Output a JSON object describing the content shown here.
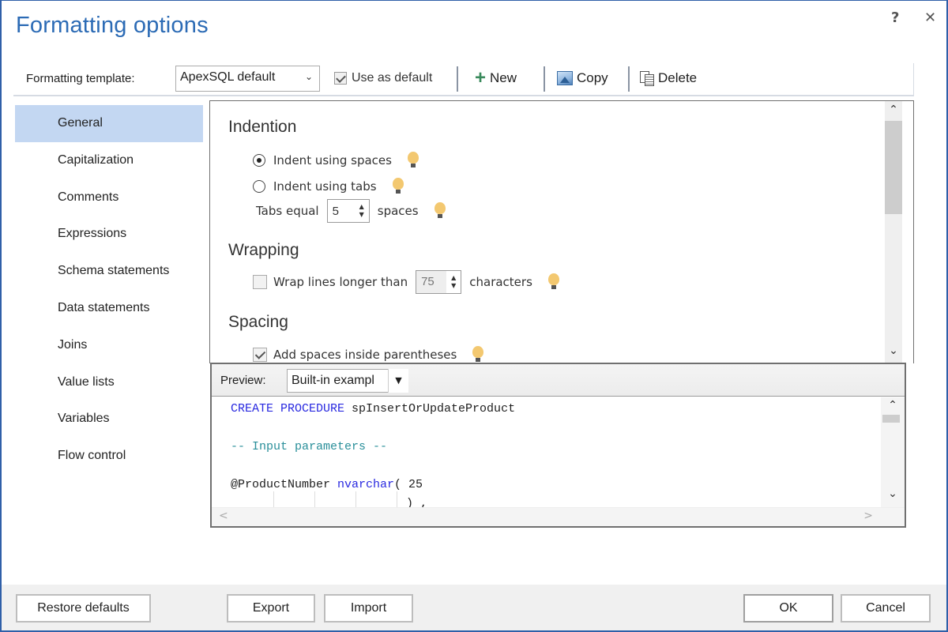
{
  "window": {
    "title": "Formatting options",
    "help_label": "?",
    "close_label": "✕"
  },
  "toolbar": {
    "template_label": "Formatting template:",
    "template_value": "ApexSQL default",
    "use_as_default_label": "Use as default",
    "use_as_default_checked": true,
    "new_label": "New",
    "copy_label": "Copy",
    "delete_label": "Delete"
  },
  "sidebar": {
    "active_index": 0,
    "items": [
      {
        "label": "General"
      },
      {
        "label": "Capitalization"
      },
      {
        "label": "Comments"
      },
      {
        "label": "Expressions"
      },
      {
        "label": "Schema statements"
      },
      {
        "label": "Data statements"
      },
      {
        "label": "Joins"
      },
      {
        "label": "Value lists"
      },
      {
        "label": "Variables"
      },
      {
        "label": "Flow control"
      }
    ]
  },
  "options": {
    "indention": {
      "heading": "Indention",
      "spaces_label": "Indent using spaces",
      "spaces_selected": true,
      "tabs_label": "Indent using tabs",
      "tabs_selected": false,
      "tabs_equal_label": "Tabs equal",
      "tabs_equal_value": "5",
      "tabs_equal_unit": "spaces"
    },
    "wrapping": {
      "heading": "Wrapping",
      "wrap_label": "Wrap lines longer than",
      "wrap_checked": false,
      "wrap_value": "75",
      "wrap_unit": "characters"
    },
    "spacing": {
      "heading": "Spacing",
      "parens_label": "Add spaces inside parentheses",
      "parens_checked": true
    }
  },
  "preview": {
    "label": "Preview:",
    "select_value": "Built-in exampl",
    "code": {
      "line1_kw": "CREATE PROCEDURE",
      "line1_rest": " spInsertOrUpdateProduct",
      "line2_comment": "-- Input parameters --",
      "line3_param": "@ProductNumber ",
      "line3_type": "nvarchar",
      "line3_rest": "( 25",
      "line4": ") ,"
    }
  },
  "footer": {
    "restore_label": "Restore defaults",
    "export_label": "Export",
    "import_label": "Import",
    "ok_label": "OK",
    "cancel_label": "Cancel"
  }
}
